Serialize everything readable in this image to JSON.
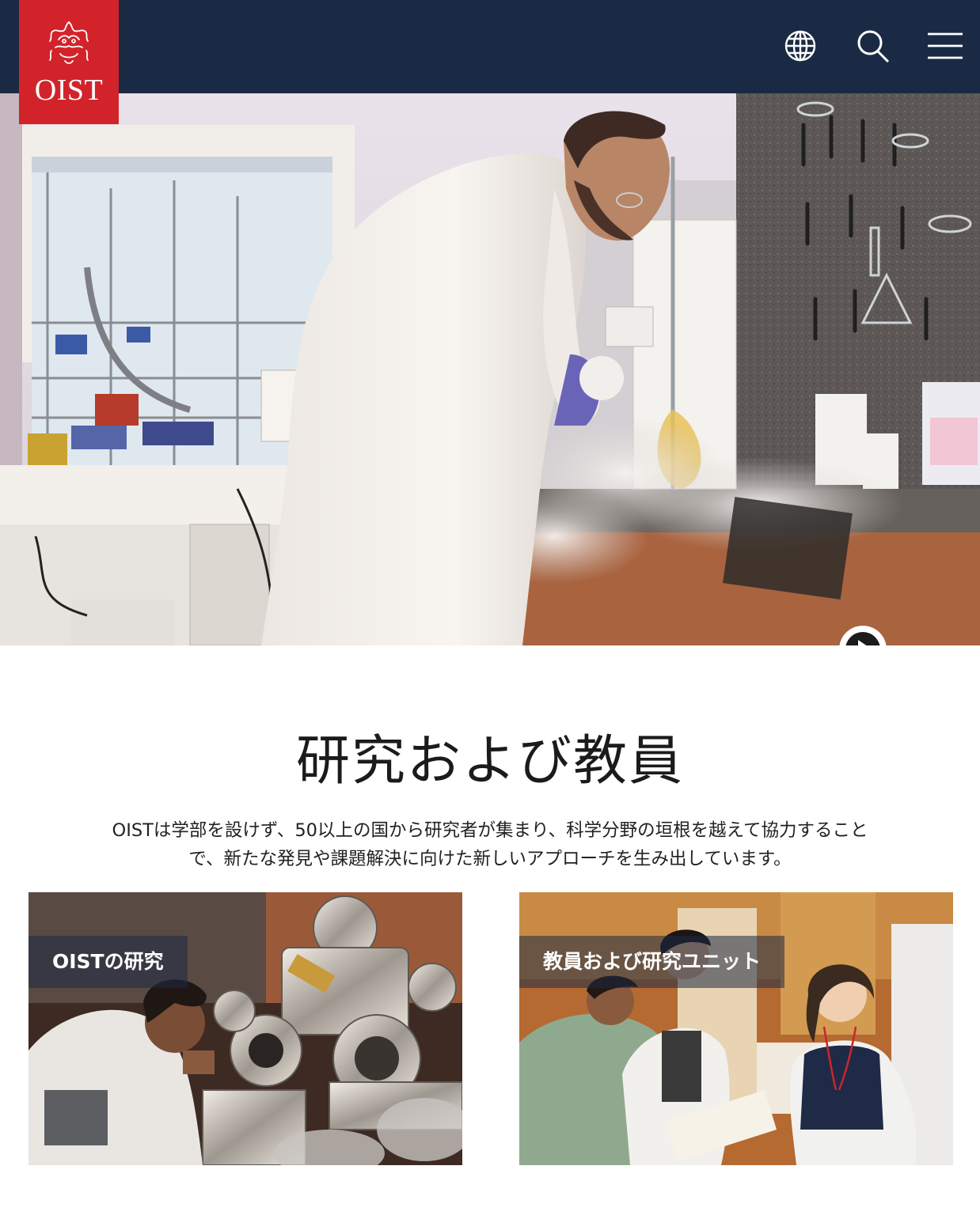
{
  "header": {
    "logo_text": "OIST",
    "icons": [
      "globe-icon",
      "search-icon",
      "menu-icon"
    ],
    "background_color": "#1b2a44",
    "logo_color": "#d3232a"
  },
  "hero": {
    "media": "video",
    "play_icon": "play-icon"
  },
  "section": {
    "title": "研究および教員",
    "description_line1": "OISTは学部を設けず、50以上の国から研究者が集まり、科学分野の垣根を越えて協力すること",
    "description_line2": "で、新たな発見や課題解決に向けた新しいアプローチを生み出しています。"
  },
  "cards": [
    {
      "label": "OISTの研究"
    },
    {
      "label": "教員および研究ユニット"
    }
  ]
}
